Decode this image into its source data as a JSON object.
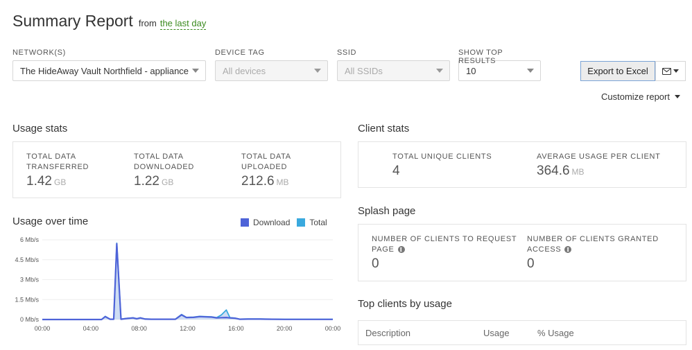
{
  "header": {
    "title": "Summary Report",
    "from_text": "from",
    "timespan": "the last day"
  },
  "filters": {
    "network": {
      "label": "NETWORK(S)",
      "value": "The HideAway Vault Northfield - appliance"
    },
    "device_tag": {
      "label": "DEVICE TAG",
      "value": "All devices",
      "disabled": true
    },
    "ssid": {
      "label": "SSID",
      "value": "All SSIDs",
      "disabled": true
    },
    "top_results": {
      "label": "SHOW TOP RESULTS",
      "value": "10"
    }
  },
  "actions": {
    "export_label": "Export to Excel",
    "email_icon": "envelope-icon",
    "customize_label": "Customize report"
  },
  "usage_stats": {
    "title": "Usage stats",
    "items": [
      {
        "label_line1": "TOTAL DATA",
        "label_line2": "TRANSFERRED",
        "value": "1.42",
        "unit": "GB"
      },
      {
        "label_line1": "TOTAL DATA",
        "label_line2": "DOWNLOADED",
        "value": "1.22",
        "unit": "GB"
      },
      {
        "label_line1": "TOTAL DATA",
        "label_line2": "UPLOADED",
        "value": "212.6",
        "unit": "MB"
      }
    ]
  },
  "client_stats": {
    "title": "Client stats",
    "items": [
      {
        "label": "TOTAL UNIQUE CLIENTS",
        "value": "4",
        "unit": ""
      },
      {
        "label": "AVERAGE USAGE PER CLIENT",
        "value": "364.6",
        "unit": "MB"
      }
    ]
  },
  "splash_page": {
    "title": "Splash page",
    "items": [
      {
        "label_line1": "NUMBER OF CLIENTS TO REQUEST",
        "label_line2": "PAGE",
        "value": "0",
        "icon": "info-icon"
      },
      {
        "label_line1": "NUMBER OF CLIENTS GRANTED",
        "label_line2": "ACCESS",
        "value": "0",
        "icon": "info-icon"
      }
    ]
  },
  "top_clients": {
    "title": "Top clients by usage",
    "columns": [
      "Description",
      "Usage",
      "% Usage"
    ]
  },
  "colors": {
    "download": "#4e63d8",
    "total": "#3aa9de",
    "area_fill": "#c9d9f2",
    "link_green": "#3a8a1e"
  },
  "chart_data": {
    "type": "area",
    "title": "Usage over time",
    "xlabel": "",
    "ylabel": "",
    "x_unit": "hours",
    "xlim": [
      0,
      24
    ],
    "ylim": [
      0,
      6
    ],
    "y_ticks": [
      0,
      1.5,
      3,
      4.5,
      6
    ],
    "y_tick_labels": [
      "0 Mb/s",
      "1.5 Mb/s",
      "3 Mb/s",
      "4.5 Mb/s",
      "6 Mb/s"
    ],
    "x_ticks": [
      0,
      4,
      8,
      12,
      16,
      20,
      24
    ],
    "x_tick_labels": [
      "00:00",
      "04:00",
      "08:00",
      "12:00",
      "16:00",
      "20:00",
      "00:00"
    ],
    "grid": true,
    "legend_position": "top-right",
    "x": [
      0,
      1,
      2,
      3,
      4,
      4.9,
      5.2,
      5.6,
      5.9,
      6.15,
      6.5,
      7,
      7.5,
      7.8,
      8.1,
      8.5,
      9,
      10,
      11,
      11.5,
      11.9,
      12.5,
      13,
      13.5,
      14,
      14.4,
      14.8,
      15.2,
      15.5,
      15.9,
      16.3,
      17,
      18,
      19,
      20,
      21,
      22,
      23,
      24
    ],
    "series": [
      {
        "name": "Download",
        "values": [
          0,
          0,
          0,
          0,
          0,
          0,
          0.22,
          0.02,
          0.02,
          5.7,
          0.02,
          0.08,
          0.12,
          0.05,
          0.12,
          0.03,
          0.02,
          0.02,
          0.02,
          0.35,
          0.15,
          0.16,
          0.22,
          0.2,
          0.18,
          0.12,
          0.14,
          0.15,
          0.12,
          0.1,
          0.02,
          0.03,
          0.03,
          0.02,
          0.01,
          0.01,
          0.01,
          0.01,
          0.01
        ]
      },
      {
        "name": "Total",
        "values": [
          0,
          0,
          0,
          0,
          0,
          0,
          0.24,
          0.02,
          0.02,
          5.75,
          0.03,
          0.09,
          0.13,
          0.06,
          0.13,
          0.04,
          0.03,
          0.03,
          0.03,
          0.38,
          0.16,
          0.18,
          0.24,
          0.22,
          0.2,
          0.14,
          0.35,
          0.72,
          0.14,
          0.11,
          0.03,
          0.04,
          0.04,
          0.03,
          0.02,
          0.02,
          0.02,
          0.02,
          0.02
        ]
      }
    ]
  }
}
